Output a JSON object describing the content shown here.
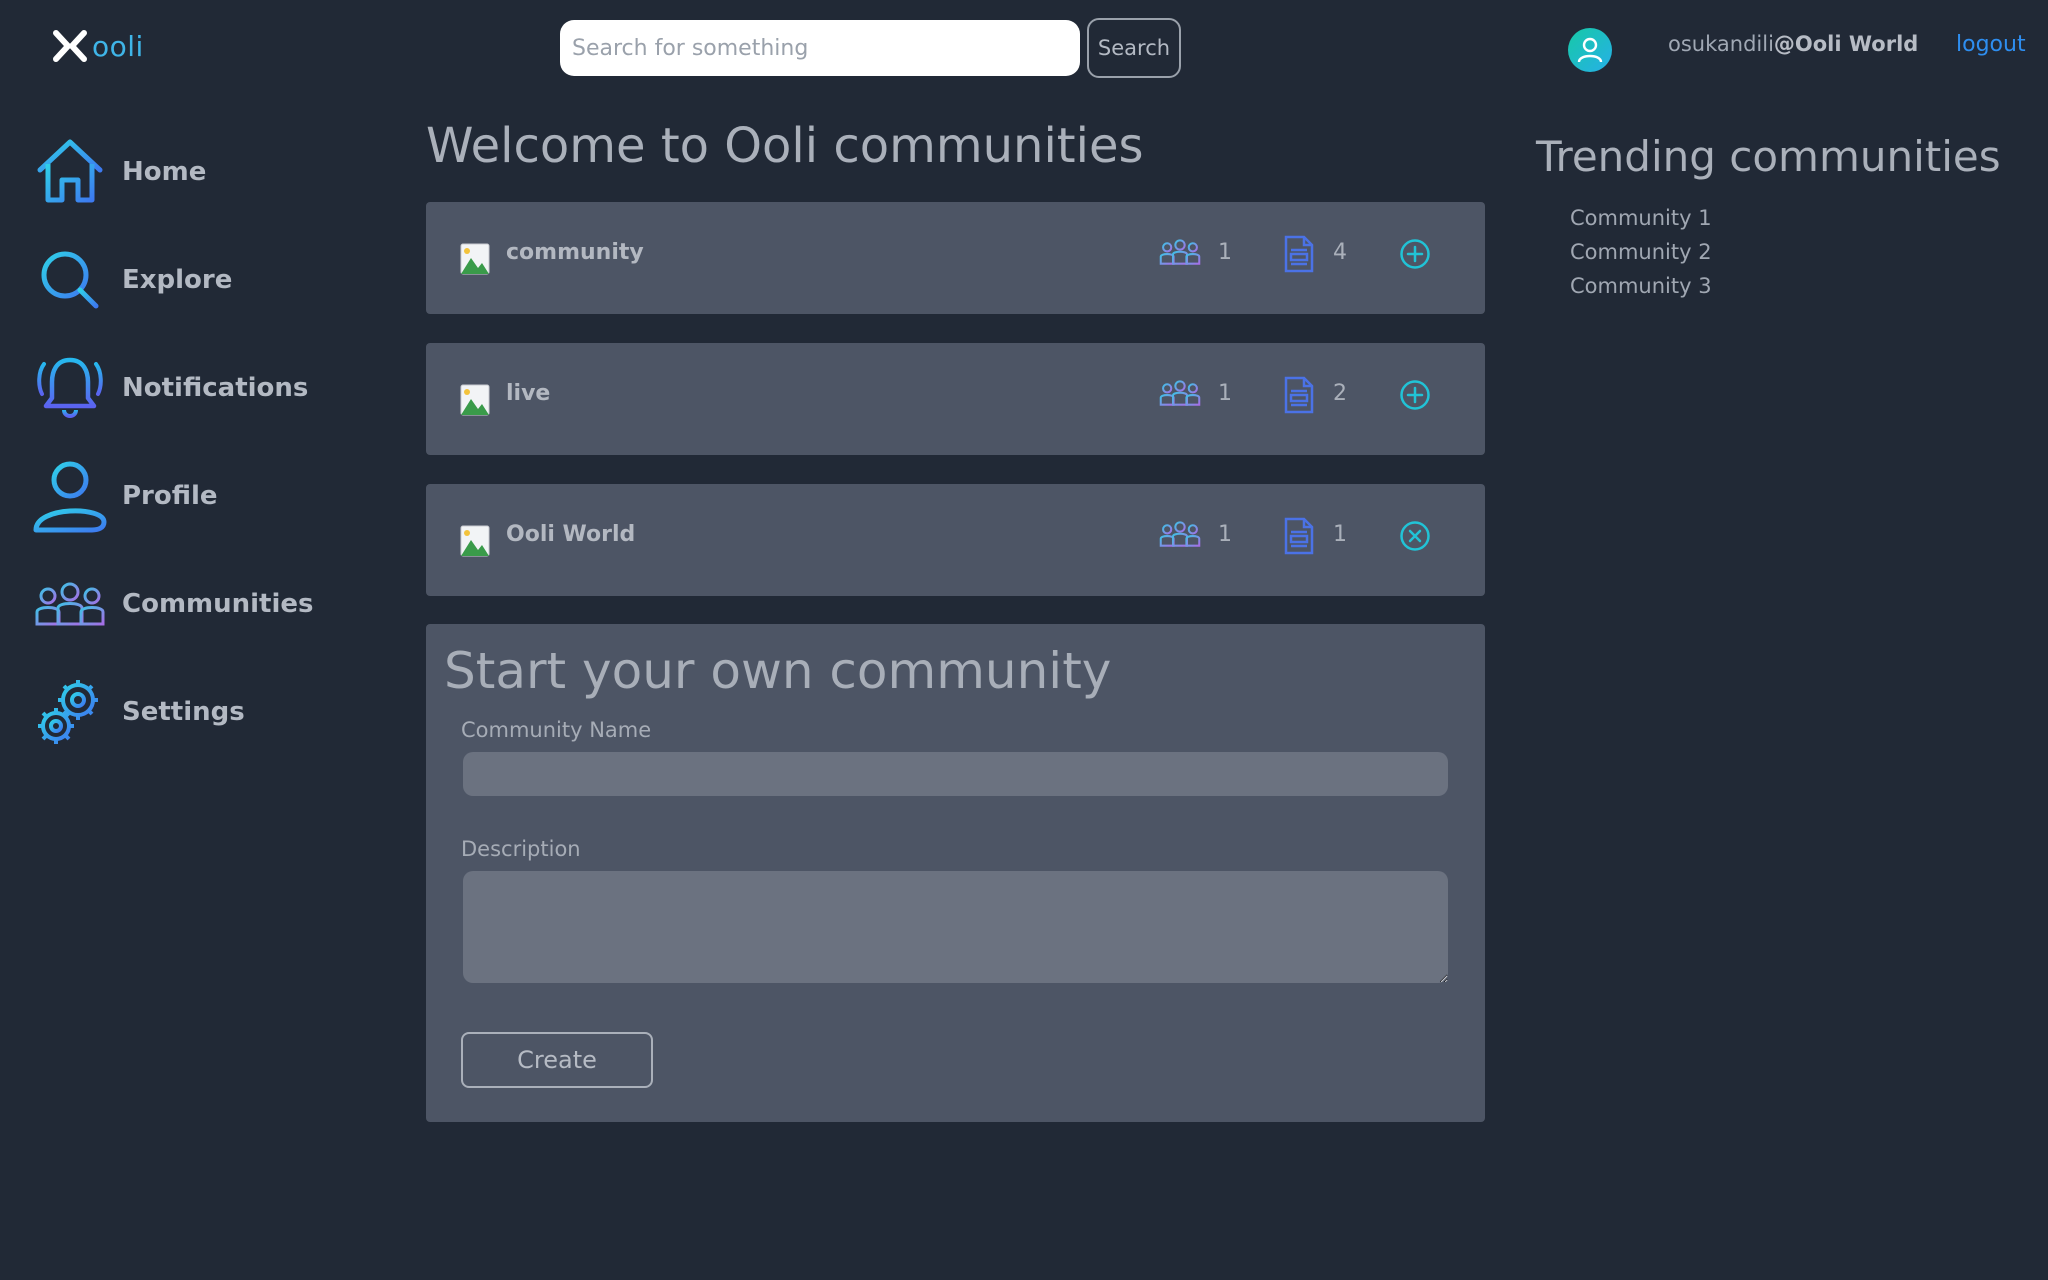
{
  "header": {
    "logo_text": "ooli",
    "search_placeholder": "Search for something",
    "search_label": "Search",
    "username": "osukandili",
    "community_suffix": "@Ooli World",
    "logout_label": "logout"
  },
  "sidebar": {
    "items": [
      {
        "label": "Home",
        "icon": "home-icon"
      },
      {
        "label": "Explore",
        "icon": "search-icon"
      },
      {
        "label": "Notifications",
        "icon": "bell-icon"
      },
      {
        "label": "Profile",
        "icon": "user-icon"
      },
      {
        "label": "Communities",
        "icon": "people-icon"
      },
      {
        "label": "Settings",
        "icon": "gear-icon"
      }
    ]
  },
  "main": {
    "title": "Welcome to Ooli communities",
    "communities": [
      {
        "name": "community",
        "members": "1",
        "posts": "4",
        "action": "join"
      },
      {
        "name": "live",
        "members": "1",
        "posts": "2",
        "action": "join"
      },
      {
        "name": "Ooli World",
        "members": "1",
        "posts": "1",
        "action": "leave"
      }
    ],
    "create": {
      "title": "Start your own community",
      "name_label": "Community Name",
      "name_value": "",
      "description_label": "Description",
      "description_value": "",
      "button_label": "Create"
    }
  },
  "trending": {
    "title": "Trending communities",
    "items": [
      "Community 1",
      "Community 2",
      "Community 3"
    ]
  },
  "colors": {
    "background": "#212936",
    "card": "#4d5565",
    "accent": "#21c3d6",
    "link": "#2e8ef0"
  }
}
